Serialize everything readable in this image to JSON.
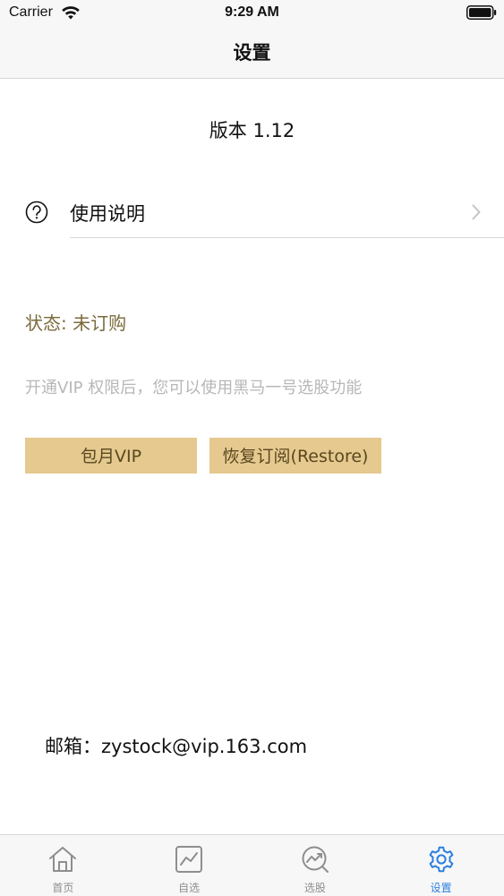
{
  "status_bar": {
    "carrier": "Carrier",
    "time": "9:29 AM"
  },
  "nav": {
    "title": "设置"
  },
  "version": "版本 1.12",
  "help": {
    "label": "使用说明"
  },
  "subscription": {
    "status": "状态: 未订购",
    "description": "开通VIP 权限后，您可以使用黑马一号选股功能",
    "monthly_button": "包月VIP",
    "restore_button": "恢复订阅(Restore)"
  },
  "contact": {
    "email": "邮箱：zystock@vip.163.com"
  },
  "tabs": [
    {
      "label": "首页",
      "icon": "home-icon"
    },
    {
      "label": "自选",
      "icon": "chart-icon"
    },
    {
      "label": "选股",
      "icon": "trend-icon"
    },
    {
      "label": "设置",
      "icon": "gear-icon"
    }
  ],
  "colors": {
    "accent": "#2b7fe0",
    "button_bg": "#e5c98e",
    "status_text": "#7a6a3a",
    "description_text": "#b7b7b7"
  }
}
